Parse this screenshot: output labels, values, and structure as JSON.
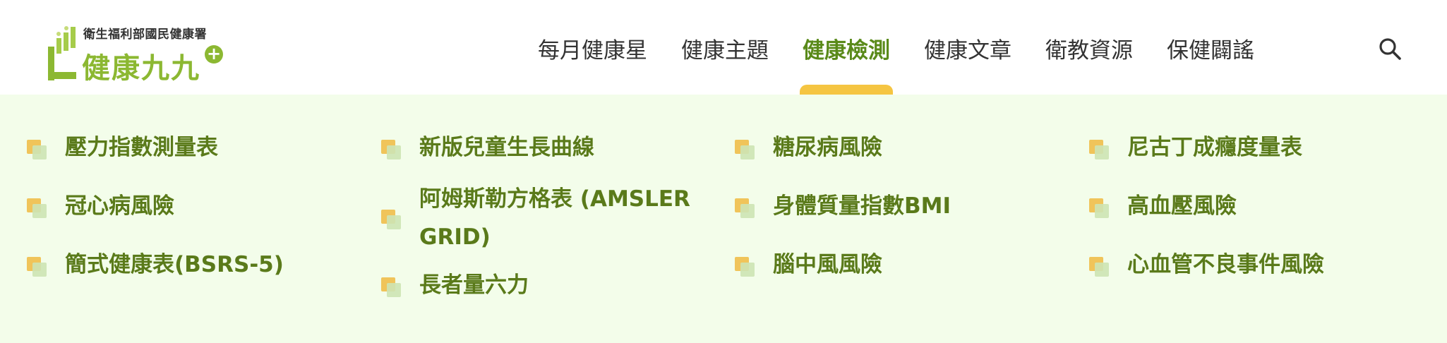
{
  "logo": {
    "agency": "衛生福利部國民健康署",
    "name": "健康九九",
    "plus": "+"
  },
  "nav": {
    "items": [
      {
        "label": "每月健康星"
      },
      {
        "label": "健康主題"
      },
      {
        "label": "健康檢測"
      },
      {
        "label": "健康文章"
      },
      {
        "label": "衛教資源"
      },
      {
        "label": "保健闢謠"
      }
    ],
    "active_index": 2
  },
  "search": {
    "icon": "search-icon"
  },
  "colors": {
    "brand_green": "#8cb832",
    "menu_text": "#5a7a1a",
    "active_underline": "#f5c542",
    "dropdown_bg": "#f3fdea"
  },
  "dropdown": {
    "columns": [
      [
        "壓力指數測量表",
        "冠心病風險",
        "簡式健康表(BSRS-5)"
      ],
      [
        "新版兒童生長曲線",
        "阿姆斯勒方格表 (AMSLER GRID)",
        "長者量六力"
      ],
      [
        "糖尿病風險",
        "身體質量指數BMI",
        "腦中風風險"
      ],
      [
        "尼古丁成癮度量表",
        "高血壓風險",
        "心血管不良事件風險"
      ]
    ]
  }
}
